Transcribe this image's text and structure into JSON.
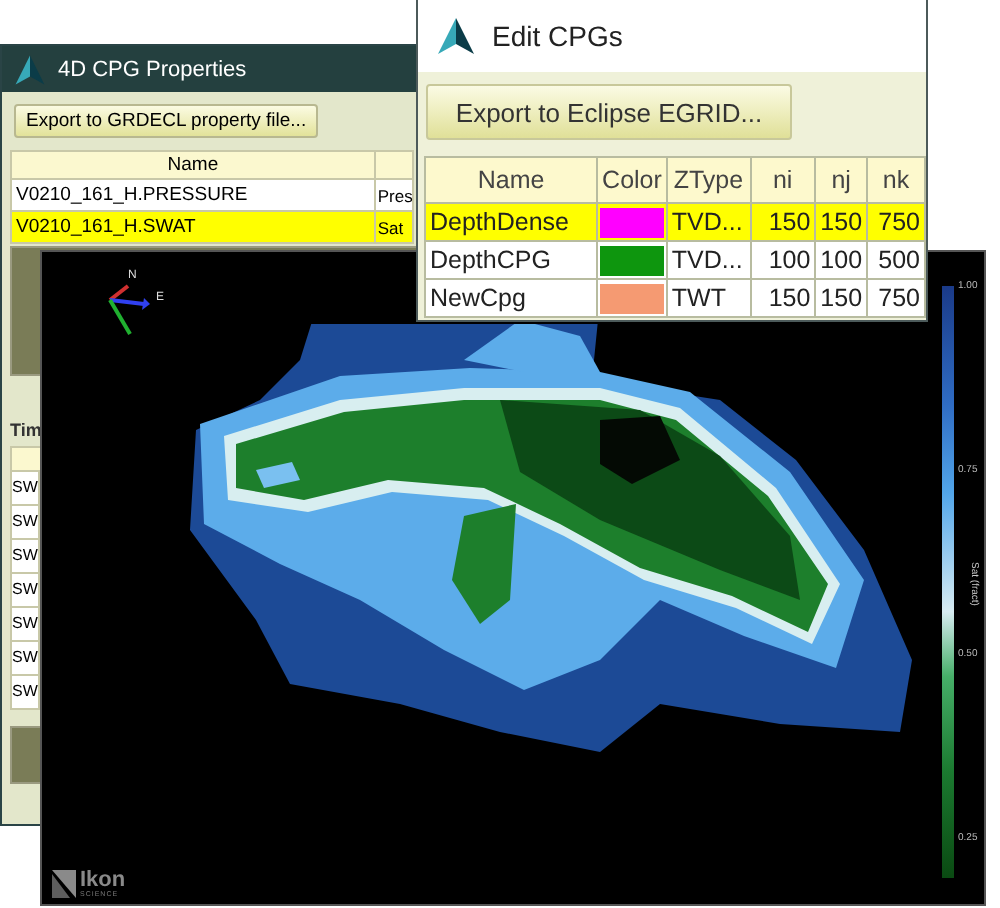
{
  "properties_window": {
    "title": "4D CPG Properties",
    "export_button": "Export to GRDECL property file...",
    "table": {
      "columns": [
        "Name"
      ],
      "rows": [
        {
          "name": "V0210_161_H.PRESSURE",
          "column_2": "Pres",
          "selected": false
        },
        {
          "name": "V0210_161_H.SWAT",
          "column_2": "Sat",
          "selected": true
        }
      ]
    },
    "time_label": "Tim",
    "time_rows": [
      "SW",
      "SW",
      "SW",
      "SW",
      "SW",
      "SW",
      "SW"
    ]
  },
  "edit_window": {
    "title": "Edit CPGs",
    "export_button": "Export to Eclipse EGRID...",
    "table": {
      "columns": [
        "Name",
        "Color",
        "ZType",
        "ni",
        "nj",
        "nk"
      ],
      "rows": [
        {
          "name": "DepthDense",
          "color": "#ff00ff",
          "ztype": "TVD...",
          "ni": "150",
          "nj": "150",
          "nk": "750",
          "selected": true
        },
        {
          "name": "DepthCPG",
          "color": "#0e960e",
          "ztype": "TVD...",
          "ni": "100",
          "nj": "100",
          "nk": "500",
          "selected": false
        },
        {
          "name": "NewCpg",
          "color": "#f59a72",
          "ztype": "TWT",
          "ni": "150",
          "nj": "150",
          "nk": "750",
          "selected": false
        }
      ]
    }
  },
  "viewer": {
    "axis_labels": [
      "N",
      "E"
    ],
    "colorbar": {
      "title": "Sat (fract)",
      "ticks": [
        "1.00",
        "0.75",
        "0.50",
        "0.25"
      ]
    },
    "logo": {
      "name": "Ikon",
      "tagline": "SCIENCE"
    }
  }
}
